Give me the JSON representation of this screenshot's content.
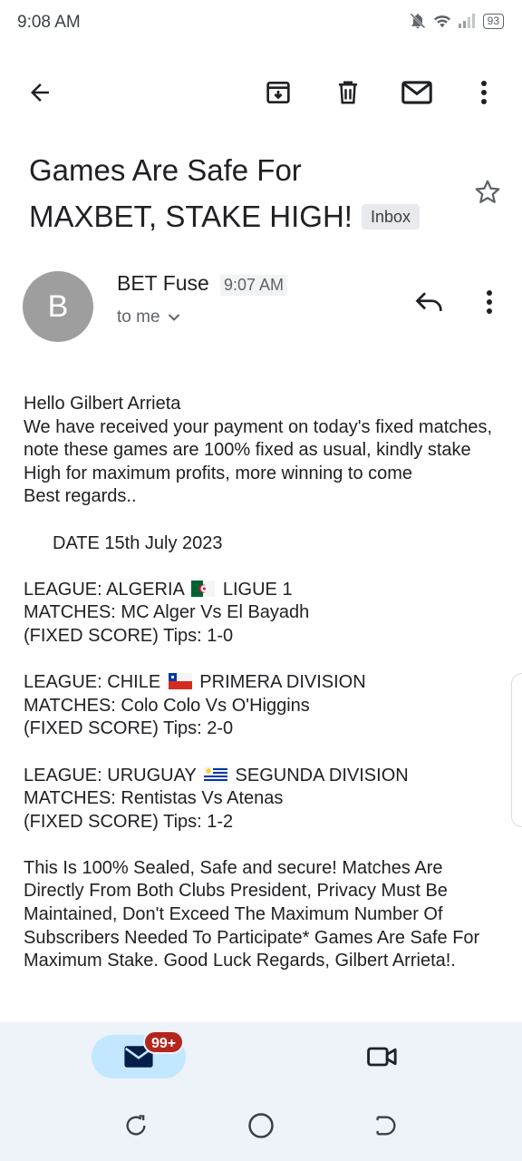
{
  "status_bar": {
    "time": "9:08 AM",
    "battery": "93"
  },
  "toolbar": {
    "back_icon": "arrow-back-icon",
    "archive_icon": "archive-icon",
    "delete_icon": "trash-icon",
    "unread_icon": "mail-icon",
    "more_icon": "more-vert-icon"
  },
  "email": {
    "subject_line1": "Games Are Safe For",
    "subject_line2": "MAXBET, STAKE HIGH!",
    "label": "Inbox",
    "sender_initial": "B",
    "sender_name": "BET Fuse",
    "time": "9:07 AM",
    "recipient": "to me",
    "body": {
      "greeting": "Hello Gilbert Arrieta",
      "intro": "We have received your payment on today's fixed matches, note these games are 100% fixed as usual, kindly stake High for maximum profits, more winning to come",
      "regards": "Best regards..",
      "date": "DATE 15th July 2023",
      "league1_prefix": "LEAGUE: ALGERIA",
      "league1_suffix": "LIGUE 1",
      "match1": "MATCHES: MC Alger Vs El Bayadh",
      "tips1": "(FIXED SCORE) Tips: 1-0",
      "league2_prefix": "LEAGUE: CHILE",
      "league2_suffix": "PRIMERA DIVISION",
      "match2": "MATCHES: Colo Colo Vs O'Higgins",
      "tips2": "(FIXED SCORE) Tips: 2-0",
      "league3_prefix": "LEAGUE: URUGUAY",
      "league3_suffix": "SEGUNDA DIVISION",
      "match3": "MATCHES: Rentistas Vs Atenas",
      "tips3": "(FIXED SCORE) Tips: 1-2",
      "closing": "This Is 100% Sealed, Safe and secure! Matches Are Directly From Both Clubs President, Privacy Must Be Maintained, Don't Exceed The Maximum Number Of Subscribers Needed To Participate* Games Are Safe For Maximum Stake. Good Luck Regards, Gilbert Arrieta!."
    }
  },
  "bottom_nav": {
    "mail_badge": "99+"
  },
  "colors": {
    "accent_pill": "#c2e7ff",
    "badge": "#b3261e",
    "nav_bg": "#eef2f9",
    "avatar": "#9e9e9e"
  }
}
